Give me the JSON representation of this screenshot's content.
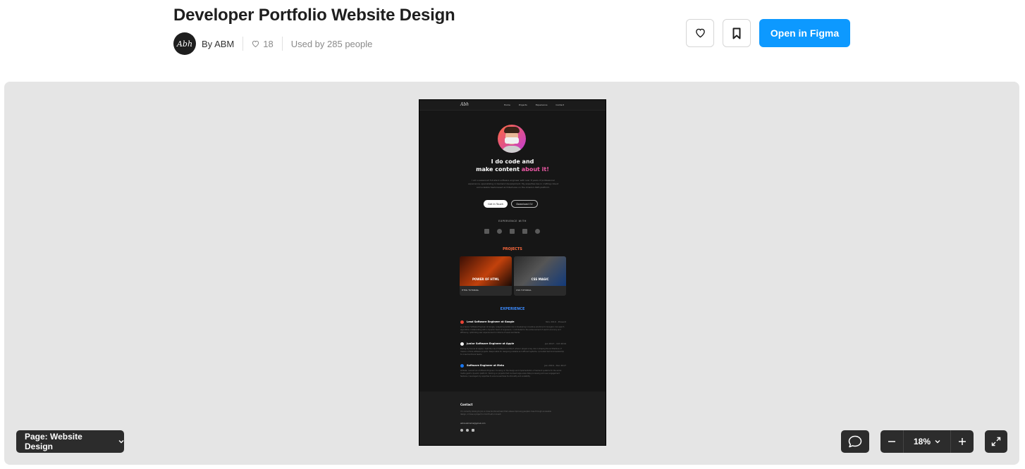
{
  "header": {
    "title": "Developer Portfolio Website Design",
    "avatar_text": "Abh",
    "author": "By ABM",
    "likes": "18",
    "used_by": "Used by 285 people",
    "open_button": "Open in Figma"
  },
  "colors": {
    "accent": "#0d99ff",
    "canvas_bg": "#e5e5e5",
    "frame_bg": "#161616",
    "control_bg": "#2c2c2c"
  },
  "preview": {
    "logo": "Abh",
    "nav": [
      "Home",
      "Projects",
      "Experience",
      "Contact"
    ],
    "hero_line1": "I do code and",
    "hero_line2_plain": "make content ",
    "hero_line2_accent": "about it!",
    "hero_paragraph": "I am a seasoned full-stack software engineer with over 8 years of professional experience, specializing in backend development. My expertise lies in crafting robust and scalable SaaS-based architectures on the Amazon AWS platform.",
    "button_primary": "Get In Touch",
    "button_secondary": "Download CV",
    "experience_with": "EXPERIENCE WITH",
    "projects_heading": "PROJECTS",
    "projects": [
      {
        "image_text": "POWER OF HTML",
        "footer": "HTML TUTORIAL"
      },
      {
        "image_text": "CSS MAGIC",
        "footer": "CSS TUTORIAL"
      }
    ],
    "experience_heading": "EXPERIENCE",
    "experience": [
      {
        "title": "Lead Software Engineer at Google",
        "dates": "Nov 2019 - Present",
        "desc": "As a Senior Software Engineer at Google, I played a pivotal role in developing innovative solutions for Google's core search algorithms. Collaborating with a dynamic team of engineers, I contributed to the enhancement of search accuracy and efficiency, optimizing user experiences for millions of users worldwide."
      },
      {
        "title": "Junior Software Engineer at Apple",
        "dates": "Jan 2017 - Oct 2019",
        "desc": "During my tenure at Apple, I held the role of Software Architect, where I played a key role in shaping the architecture of mission-critical software projects. Responsible for designing scalable and efficient systems, I provided technical leadership to cross-functional teams."
      },
      {
        "title": "Software Engineer at Meta",
        "dates": "Jan 2016 - Dec 2017",
        "desc": "At Meta, I served as a Software Engineer, focusing on the design and implementation of backend systems for the social media giant's dynamic platform. Working on projects that involved large-scale data processing and user engagement features, I leveraged my expertise to ensure seamless functionality and scalability."
      }
    ],
    "contact_heading": "Contact",
    "contact_text": "I'm currently looking to join a cross-functional team that values improving people's lives through accessible design, or have a project in mind? Let's connect.",
    "email": "abhinabmishra@gmail.com"
  },
  "controls": {
    "page_label": "Page: Website Design",
    "zoom": "18%"
  }
}
